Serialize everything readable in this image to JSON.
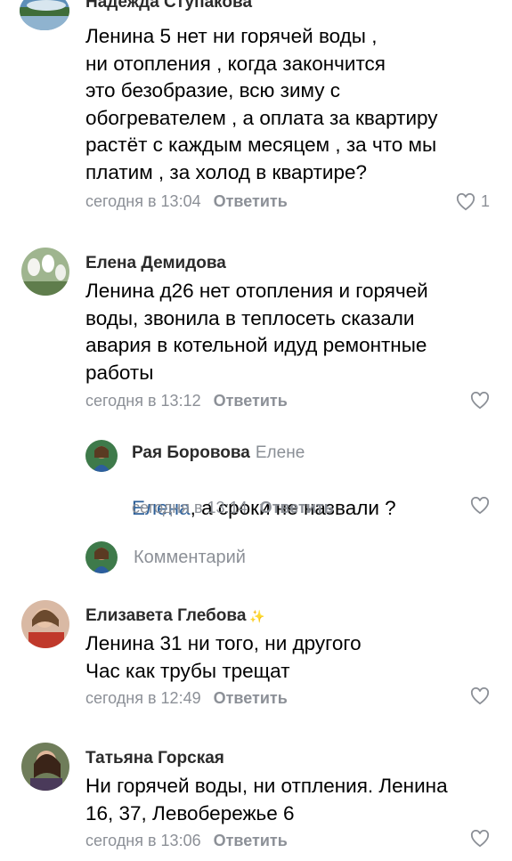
{
  "comments": [
    {
      "author": "Надежда Ступакова",
      "text": "Ленина 5 нет ни горячей воды ,\nни отопления , когда закончится\nэто безобразие, всю зиму с\nобогревателем , а оплата за квартиру\nрастёт с каждым месяцем , за что мы\nплатим , за холод в квартире?",
      "time": "сегодня в 13:04",
      "reply_label": "Ответить",
      "likes": "1"
    },
    {
      "author": "Елена Демидова",
      "text": "Ленина д26 нет отопления и горячей\nводы, звонила в теплосеть сказали\nавария в котельной идуд ремонтные\nработы",
      "time": "сегодня в 13:12",
      "reply_label": "Ответить"
    },
    {
      "author": "Рая Боровова",
      "reply_to": "Елене",
      "mention": "Елена",
      "text": ", а сроки не назвали ?",
      "time": "сегодня в 13:14",
      "reply_label": "Ответить"
    },
    {
      "author": "Елизавета Глебова",
      "text": "Ленина 31 ни того, ни другого\nЧас как трубы трещат",
      "time": "сегодня в 12:49",
      "reply_label": "Ответить"
    },
    {
      "author": "Татьяна Горская",
      "text": "Ни горячей воды, ни отпления. Ленина\n16, 37, Левобережье 6",
      "time": "сегодня в 13:06",
      "reply_label": "Ответить"
    }
  ],
  "compose": {
    "placeholder": "Комментарий"
  },
  "icons": {
    "like": "heart-outline-icon",
    "elizaveta_badge": "sparkle-emoji-icon"
  },
  "colors": {
    "meta": "#8c9097",
    "mention": "#2c5f99",
    "text": "#000000"
  }
}
